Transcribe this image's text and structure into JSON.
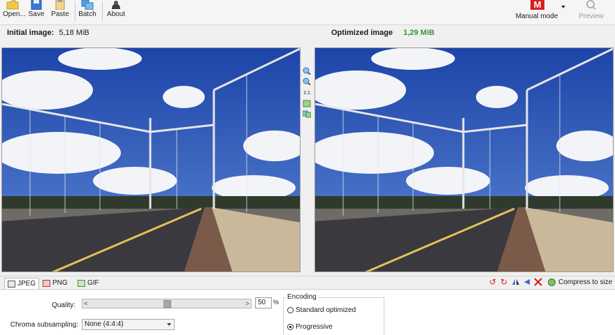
{
  "toolbar": {
    "open_label": "Open...",
    "save_label": "Save",
    "paste_label": "Paste",
    "batch_label": "Batch",
    "about_label": "About",
    "mode_label": "Manual mode",
    "mode_letter": "M",
    "preview_label": "Preview"
  },
  "header": {
    "initial_label": "Initial image:",
    "initial_size": "5,18 MiB",
    "optimized_label": "Optimized image",
    "optimized_size": "1,29 MiB"
  },
  "side_tools": {
    "zoom_in": "zoom-in-icon",
    "zoom_out": "zoom-out-icon",
    "actual_size": "1:1",
    "fit": "fit-icon",
    "compare": "compare-icon"
  },
  "formats": {
    "tabs": [
      "JPEG",
      "PNG",
      "GIF"
    ],
    "active": "JPEG"
  },
  "compress_label": "Compress to size",
  "settings": {
    "quality_label": "Quality:",
    "quality_value": "50",
    "quality_unit": "%",
    "quality_fraction": 0.5,
    "chroma_label": "Chroma subsampling:",
    "chroma_value": "None (4:4:4)",
    "encoding_title": "Encoding",
    "encoding_options": [
      "Standard optimized",
      "Progressive"
    ],
    "encoding_selected": "Progressive"
  },
  "colors": {
    "accent_green": "#2e9a2e",
    "manual_red": "#d81e1e"
  }
}
